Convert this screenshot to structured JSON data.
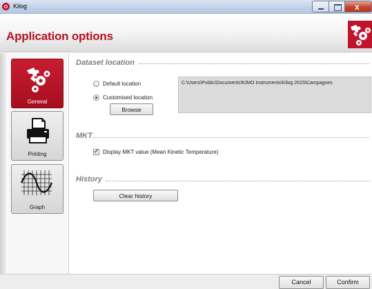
{
  "window": {
    "title": "Kilog",
    "controls": {
      "minimize": "minimize-icon",
      "maximize": "maximize-icon",
      "close": "x"
    }
  },
  "header": {
    "title": "Application options",
    "logo_icon": "wrench-gears-icon",
    "accent_color": "#c0142c"
  },
  "sidebar": {
    "items": [
      {
        "label": "General",
        "icon": "wrench-gears-icon",
        "active": true
      },
      {
        "label": "Printing",
        "icon": "printer-icon",
        "active": false
      },
      {
        "label": "Graph",
        "icon": "graph-grid-icon",
        "active": false
      }
    ]
  },
  "dataset_location": {
    "heading": "Dataset location",
    "default_label": "Default location",
    "customised_label": "Customised location",
    "selected": "customised",
    "browse_label": "Browse",
    "path": "C:\\Users\\Public\\Documents\\KIMO Instruments\\Kilog 2015\\Campagnes"
  },
  "mkt": {
    "heading": "MKT",
    "checkbox_label": "Display MKT value (Mean Kinetic Temperature)",
    "checked": true
  },
  "history": {
    "heading": "History",
    "clear_label": "Clear history"
  },
  "footer": {
    "cancel_label": "Cancel",
    "confirm_label": "Confirm"
  }
}
